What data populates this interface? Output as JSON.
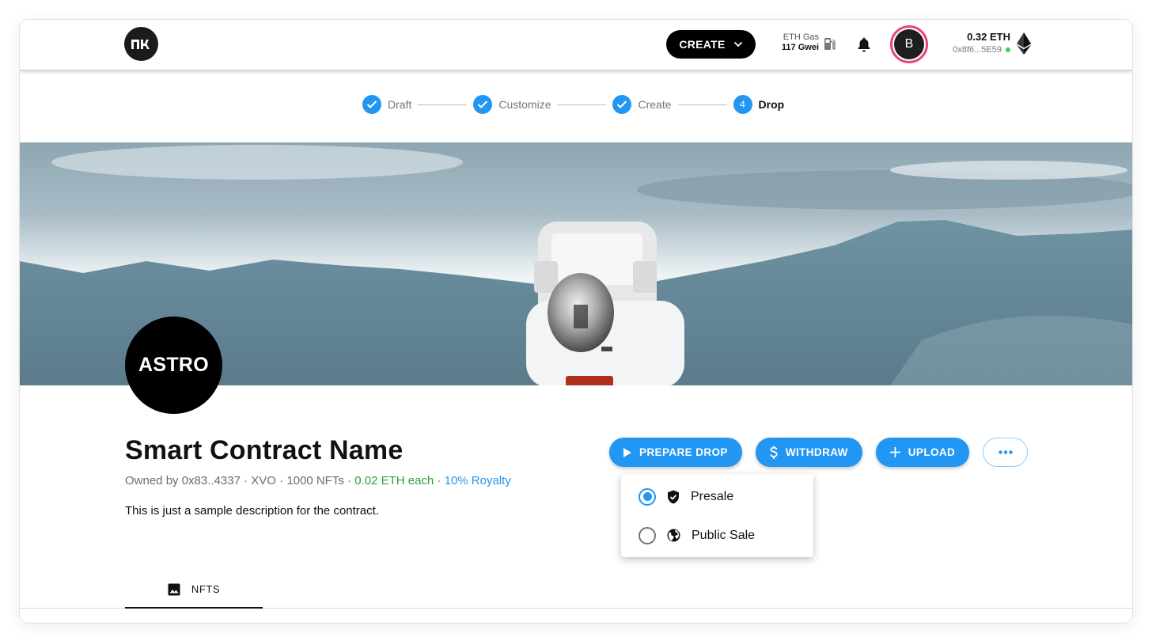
{
  "header": {
    "logo_text": "nk",
    "create_label": "CREATE",
    "gas_label": "ETH Gas",
    "gas_value": "117 Gwei",
    "avatar_initial": "B",
    "balance": "0.32 ETH",
    "address": "0x8f6...5E59",
    "icons": [
      "logo",
      "chevron-down-icon",
      "gas-pump-icon",
      "bell-icon",
      "ethereum-icon"
    ]
  },
  "stepper": {
    "steps": [
      {
        "label": "Draft",
        "state": "done"
      },
      {
        "label": "Customize",
        "state": "done"
      },
      {
        "label": "Create",
        "state": "done"
      },
      {
        "label": "Drop",
        "state": "active",
        "number": "4"
      }
    ]
  },
  "contract": {
    "avatar_text": "ASTRO",
    "name": "Smart Contract Name",
    "owner": "Owned by 0x83..4337",
    "symbol": "XVO",
    "supply": "1000 NFTs",
    "price": "0.02 ETH each",
    "royalty": "10% Royalty",
    "separator": " · ",
    "description": "This is just a sample description for the contract."
  },
  "actions": {
    "prepare_drop": "PREPARE DROP",
    "withdraw": "WITHDRAW",
    "upload": "UPLOAD",
    "more": "more-options"
  },
  "drop_menu": {
    "options": [
      {
        "label": "Presale",
        "icon": "shield-check-icon",
        "selected": true
      },
      {
        "label": "Public Sale",
        "icon": "globe-icon",
        "selected": false
      }
    ]
  },
  "tabs": [
    {
      "label": "NFTS",
      "icon": "image-icon",
      "active": true
    }
  ],
  "colors": {
    "primary": "#2196f3",
    "accent_ring": "#e8457a",
    "price_green": "#2e9e3e",
    "online_dot": "#3ccf5a"
  }
}
